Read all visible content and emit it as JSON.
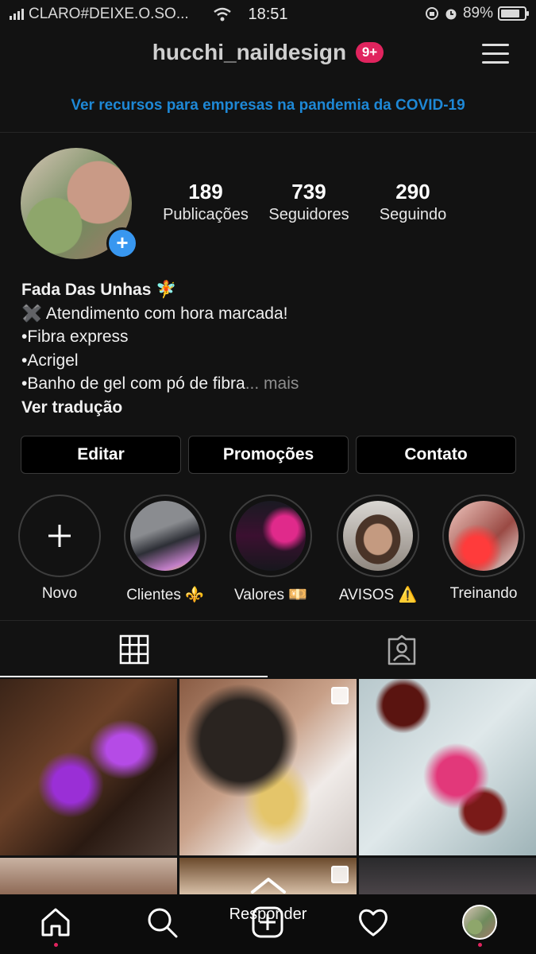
{
  "status_bar": {
    "carrier": "CLARO#DEIXE.O.SO...",
    "time": "18:51",
    "battery": "89%",
    "battery_level": 0.89
  },
  "header": {
    "username": "hucchi_naildesign",
    "notification_badge": "9+"
  },
  "banner": {
    "text": "Ver recursos para empresas na pandemia da COVID-19"
  },
  "stats": [
    {
      "value": "189",
      "label": "Publicações"
    },
    {
      "value": "739",
      "label": "Seguidores"
    },
    {
      "value": "290",
      "label": "Seguindo"
    }
  ],
  "bio": {
    "name": "Fada Das Unhas 🧚",
    "line1": "✖️ Atendimento com hora marcada!",
    "line2": "•Fibra express",
    "line3": "•Acrigel",
    "line4": "•Banho de gel com pó de fibra",
    "more": "... mais",
    "translate": "Ver tradução"
  },
  "buttons": {
    "edit": "Editar",
    "promotions": "Promoções",
    "contact": "Contato"
  },
  "highlights": [
    {
      "label": "Novo"
    },
    {
      "label": "Clientes ⚜️"
    },
    {
      "label": "Valores 💴"
    },
    {
      "label": "AVISOS ⚠️"
    },
    {
      "label": "Treinando"
    }
  ],
  "bottom": {
    "reply": "Responder"
  },
  "icons": {
    "menu": "hamburger-menu-icon",
    "grid_tab": "grid-icon",
    "tagged_tab": "tagged-person-icon",
    "home": "home-icon",
    "search": "search-icon",
    "add": "add-post-icon",
    "activity": "heart-icon",
    "profile": "profile-avatar-icon"
  },
  "colors": {
    "background": "#121212",
    "link_blue": "#1e88d6",
    "badge_red": "#e0245e",
    "add_blue": "#3897f0"
  }
}
